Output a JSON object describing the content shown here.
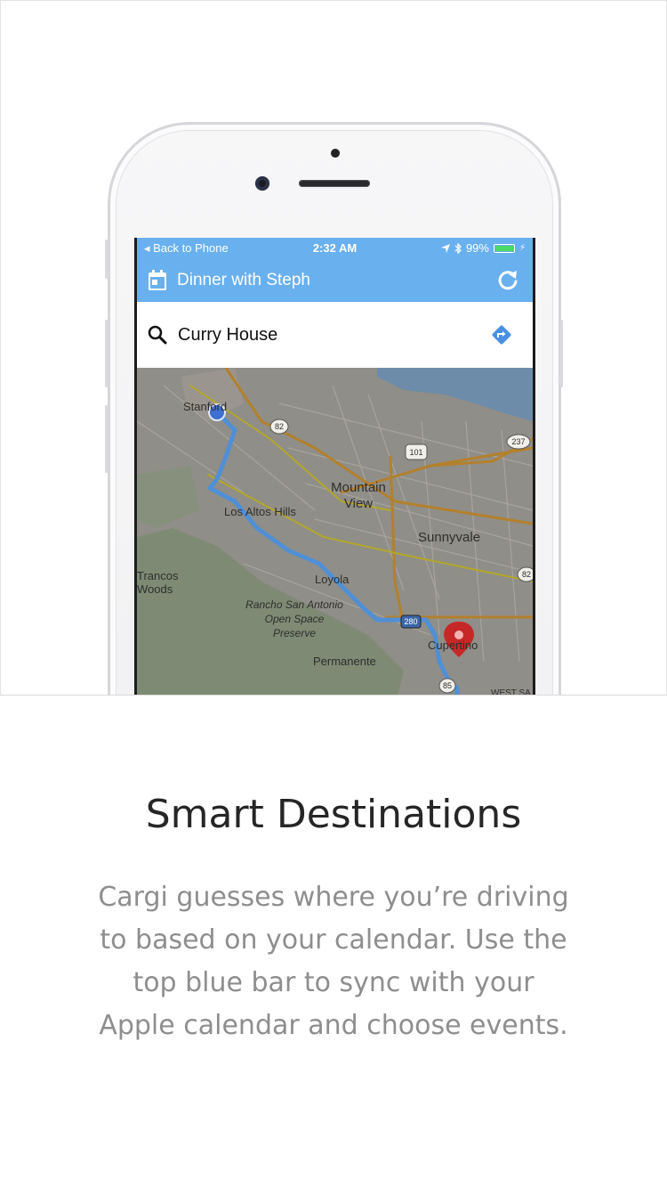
{
  "status_bar": {
    "back_label": "Back to Phone",
    "time": "2:32 AM",
    "battery": "99%",
    "battery_level": 0.99
  },
  "app_bar": {
    "event_title": "Dinner with Steph",
    "calendar_icon": "calendar-icon",
    "refresh_icon": "refresh-icon"
  },
  "search": {
    "query": "Curry House",
    "search_icon": "search-icon",
    "directions_icon": "directions-icon"
  },
  "map": {
    "places": [
      "Stanford",
      "Mountain View",
      "Sunnyvale",
      "Los Altos Hills",
      "Loyola",
      "Rancho San Antonio Open Space Preserve",
      "Permanente",
      "Cupertino",
      "Trancos Woods",
      "WEST SA"
    ],
    "highways": [
      "82",
      "101",
      "237",
      "280",
      "85",
      "82"
    ],
    "route_color": "#4f8fd6",
    "origin_color": "#3f6fd1",
    "destination_pin_color": "#c62828"
  },
  "feature": {
    "headline": "Smart Destinations",
    "body": "Cargi guesses where you’re driving to based on your calendar. Use the top blue bar to sync with your Apple calendar and choose events."
  }
}
